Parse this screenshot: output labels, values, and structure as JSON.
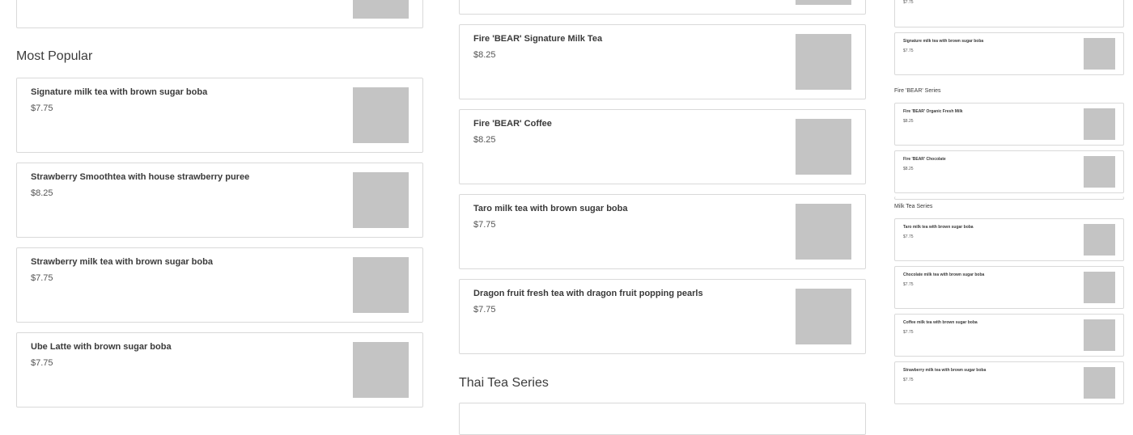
{
  "left": {
    "section_title": "Most Popular",
    "items": [
      {
        "name": "Signature milk tea with brown sugar boba",
        "price": "$7.75"
      },
      {
        "name": "Strawberry Smoothtea with house strawberry puree",
        "price": "$8.25"
      },
      {
        "name": "Strawberry milk tea with brown sugar boba",
        "price": "$7.75"
      },
      {
        "name": "Ube Latte with brown sugar boba",
        "price": "$7.75"
      }
    ]
  },
  "middle": {
    "items": [
      {
        "name": "Fire 'BEAR' Signature Milk Tea",
        "price": "$8.25"
      },
      {
        "name": "Fire 'BEAR' Coffee",
        "price": "$8.25"
      },
      {
        "name": "Taro milk tea with brown sugar boba",
        "price": "$7.75"
      },
      {
        "name": "Dragon fruit fresh tea with dragon fruit popping pearls",
        "price": "$7.75"
      }
    ],
    "next_section_title": "Thai Tea Series"
  },
  "right": {
    "top_partial_price": "$7.75",
    "first_item": {
      "name": "Signature milk tea with brown sugar boba",
      "price": "$7.75"
    },
    "fire_bear_series": {
      "title": "Fire 'BEAR' Series",
      "items": [
        {
          "name": "Fire 'BEAR' Organic Fresh Milk",
          "price": "$8.25"
        },
        {
          "name": "Fire 'BEAR' Chocolate",
          "price": "$8.25"
        }
      ]
    },
    "milk_tea_series": {
      "title": "Milk Tea Series",
      "items": [
        {
          "name": "Taro milk tea with brown sugar boba",
          "price": "$7.75"
        },
        {
          "name": "Chocolate milk tea with brown sugar boba",
          "price": "$7.75"
        },
        {
          "name": "Coffee milk tea with brown sugar boba",
          "price": "$7.75"
        },
        {
          "name": "Strawberry milk tea with brown sugar boba",
          "price": "$7.75"
        }
      ]
    }
  }
}
